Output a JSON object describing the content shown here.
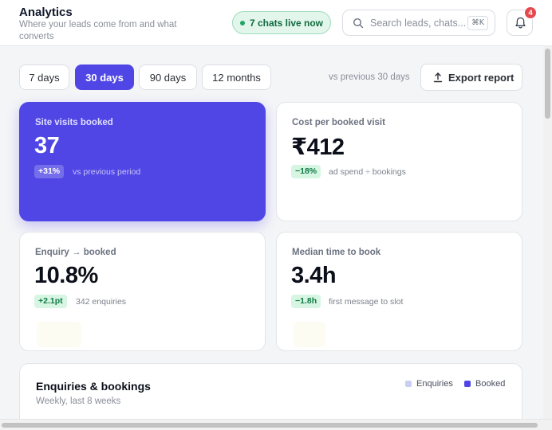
{
  "header": {
    "title": "Analytics",
    "subtitle": "Where your leads come from and what converts",
    "live_chats": "7 chats live now",
    "search_placeholder": "Search leads, chats...",
    "search_shortcut": "⌘K",
    "notification_count": "4"
  },
  "toolbar": {
    "ranges": [
      {
        "label": "7 days",
        "active": false
      },
      {
        "label": "30 days",
        "active": true
      },
      {
        "label": "90 days",
        "active": false
      },
      {
        "label": "12 months",
        "active": false
      }
    ],
    "comparison": "vs previous 30 days",
    "export_label": "Export report"
  },
  "kpis": [
    {
      "label": "Site visits booked",
      "value": "37",
      "delta": "+31%",
      "note": "vs previous period"
    },
    {
      "label": "Cost per booked visit",
      "value": "₹412",
      "delta": "−18%",
      "note": "ad spend ÷ bookings"
    },
    {
      "label": "Enquiry → booked",
      "value": "10.8%",
      "delta": "+2.1pt",
      "note": "342 enquiries"
    },
    {
      "label": "Median time to book",
      "value": "3.4h",
      "delta": "−1.8h",
      "note": "first message to slot"
    }
  ],
  "chart": {
    "title": "Enquiries & bookings",
    "subtitle": "Weekly, last 8 weeks",
    "legend": [
      {
        "label": "Enquiries",
        "color": "#c7cff5"
      },
      {
        "label": "Booked",
        "color": "#4f46e5"
      }
    ]
  },
  "colors": {
    "accent": "#4f46e5",
    "positive_bg": "#d6f5e3",
    "positive_text": "#0f7a44",
    "live_green": "#22a565",
    "badge_red": "#e5484d"
  }
}
